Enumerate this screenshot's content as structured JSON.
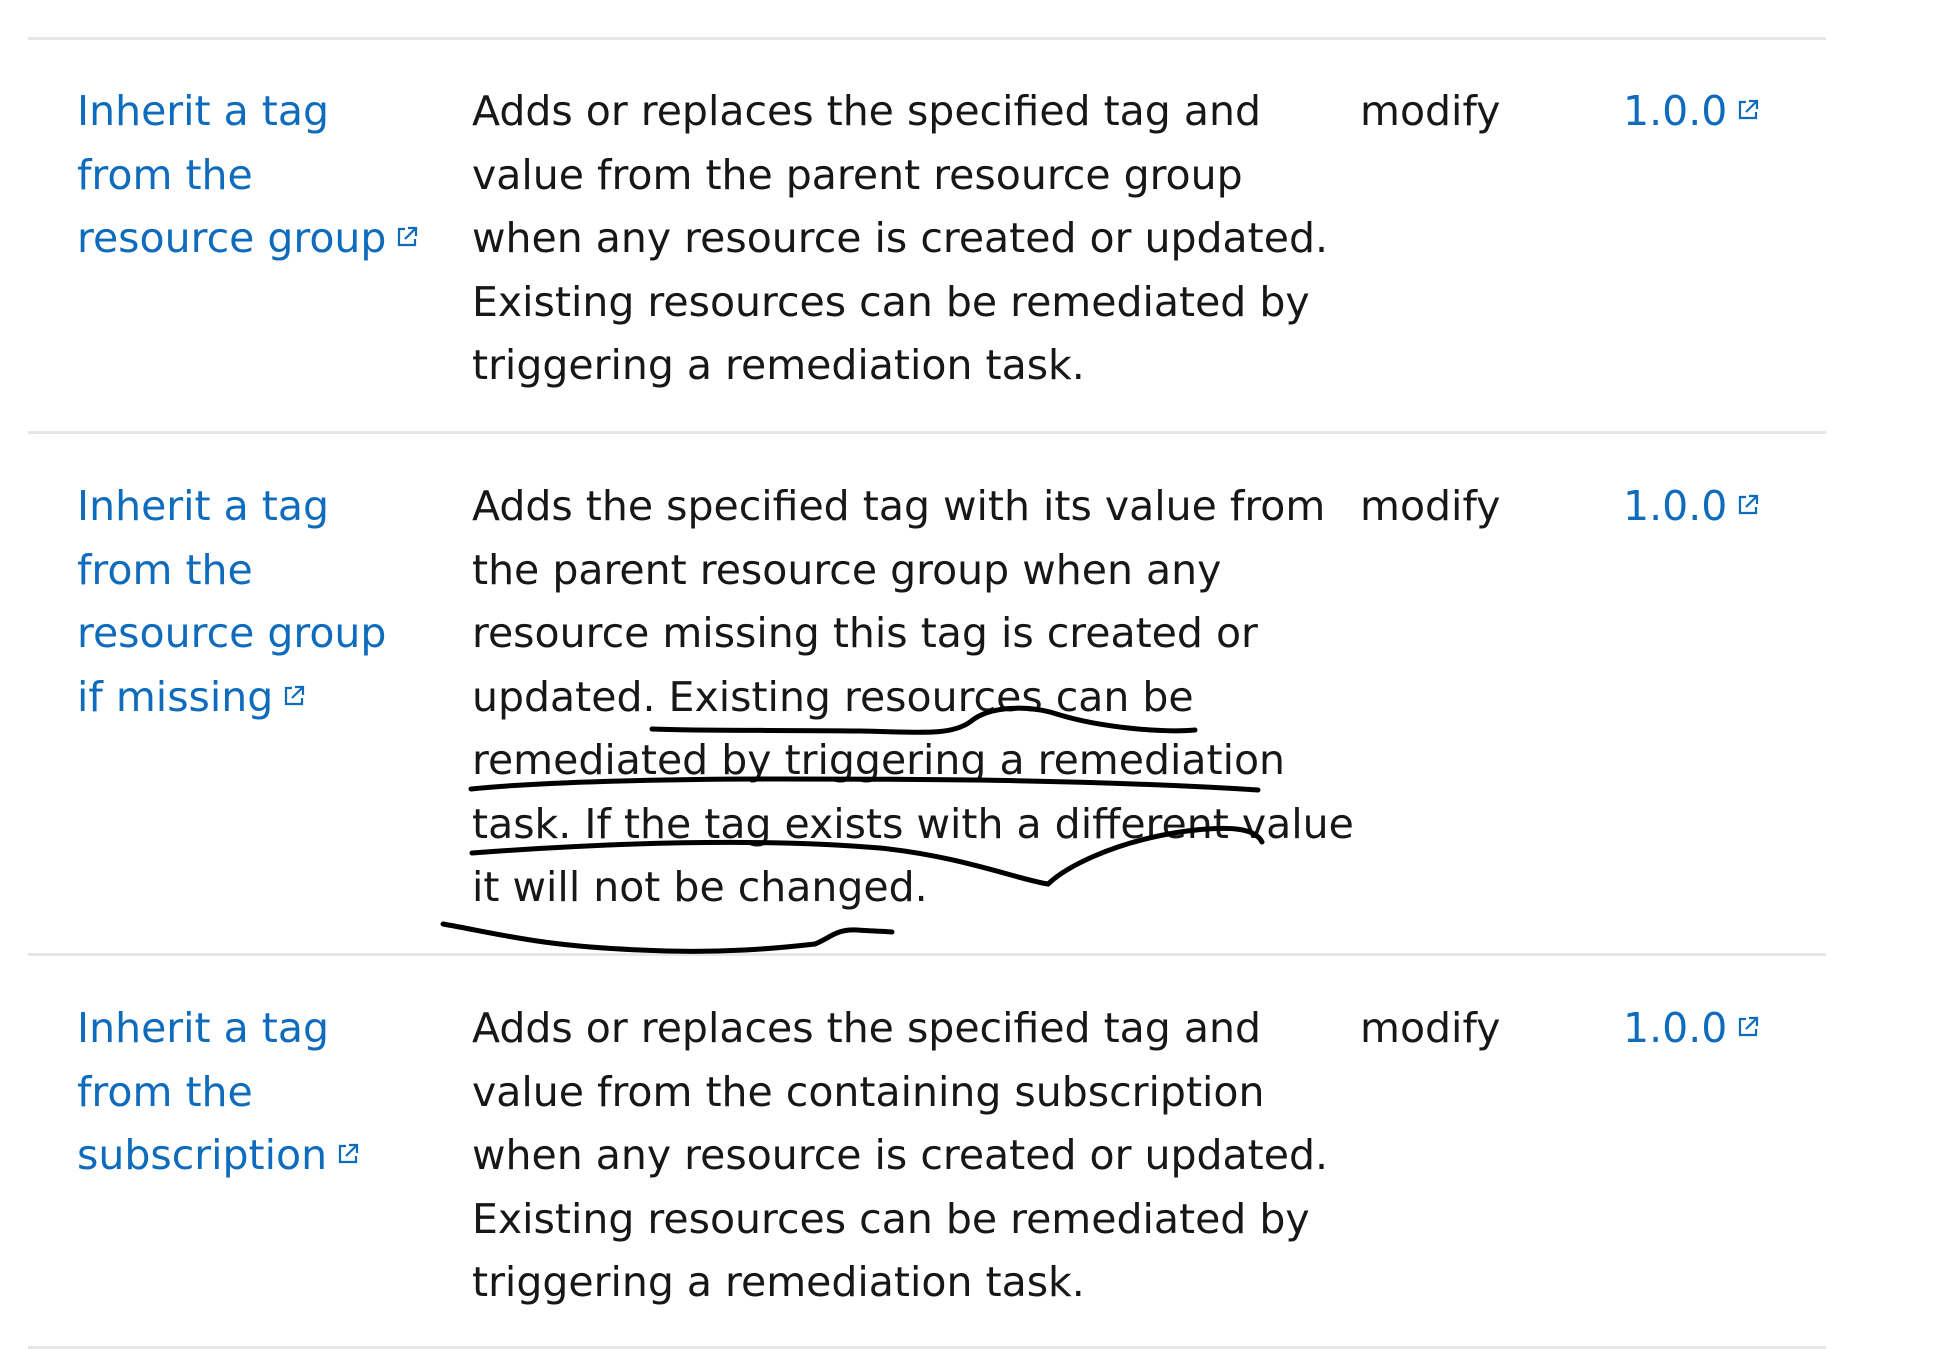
{
  "rows": [
    {
      "name_lines": [
        "Inherit a tag",
        "from the",
        "resource group"
      ],
      "description_lines": [
        "Adds or replaces the specified tag and",
        "value from the parent resource group",
        "when any resource is created or updated.",
        "Existing resources can be remediated by",
        "triggering a remediation task."
      ],
      "effect": "modify",
      "version": "1.0.0"
    },
    {
      "name_lines": [
        "Inherit a tag",
        "from the",
        "resource group",
        "if missing"
      ],
      "description_lines": [
        "Adds the specified tag with its value from",
        "the parent resource group when any",
        "resource missing this tag is created or",
        "updated. Existing resources can be",
        "remediated by triggering a remediation",
        "task. If the tag exists with a different value",
        "it will not be changed."
      ],
      "effect": "modify",
      "version": "1.0.0"
    },
    {
      "name_lines": [
        "Inherit a tag",
        "from the",
        "subscription"
      ],
      "description_lines": [
        "Adds or replaces the specified tag and",
        "value from the containing subscription",
        "when any resource is created or updated.",
        "Existing resources can be remediated by",
        "triggering a remediation task."
      ],
      "effect": "modify",
      "version": "1.0.0"
    }
  ],
  "icons": {
    "external_link": "external-link-icon"
  },
  "colors": {
    "link": "#0f6cbd",
    "text": "#171717",
    "rule": "#e6e6e6",
    "annotation": "#000000"
  }
}
